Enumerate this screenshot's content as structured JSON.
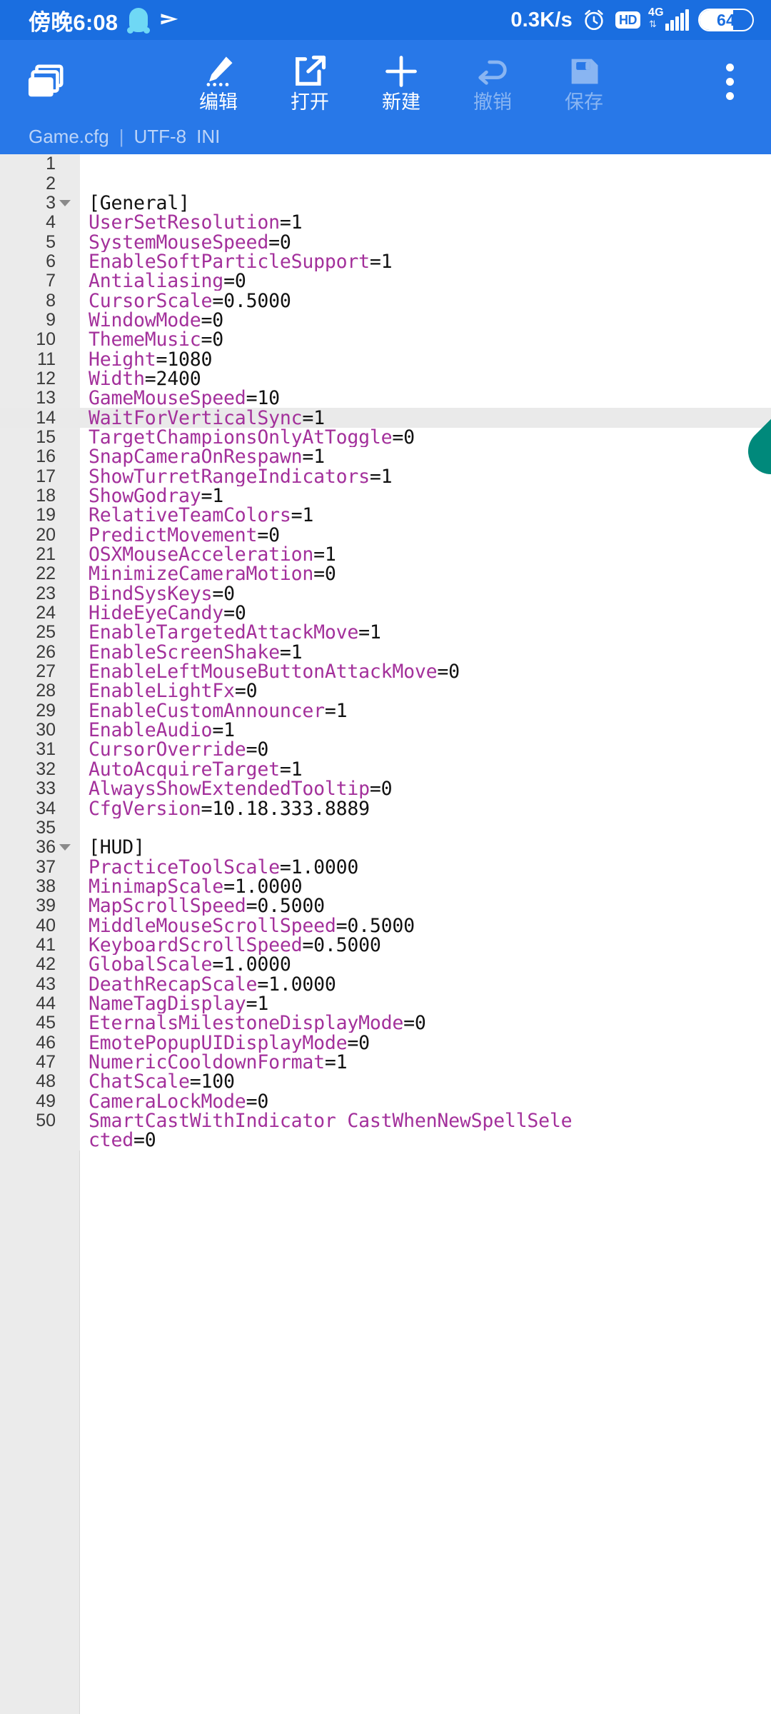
{
  "statusbar": {
    "time": "傍晚6:08",
    "qq_icon": "qq-penguin-icon",
    "plane_icon": "paper-plane-icon",
    "network_speed": "0.3K/s",
    "alarm_icon": "alarm-clock-icon",
    "hd_badge": "HD",
    "signal_type": "4G",
    "battery_level": "64",
    "bg_color": "#1a6ee0"
  },
  "toolbar": {
    "bg_color": "#2878e8",
    "windows_icon": "window-stack-icon",
    "items": [
      {
        "label": "编辑",
        "icon": "pencil-edit-icon",
        "enabled": true
      },
      {
        "label": "打开",
        "icon": "open-external-icon",
        "enabled": true
      },
      {
        "label": "新建",
        "icon": "plus-new-icon",
        "enabled": true
      },
      {
        "label": "撤销",
        "icon": "undo-arrow-icon",
        "enabled": false
      },
      {
        "label": "保存",
        "icon": "floppy-save-icon",
        "enabled": false
      }
    ],
    "overflow_icon": "more-vertical-icon"
  },
  "fileinfo": {
    "filename": "Game.cfg",
    "separator": "|",
    "encoding": "UTF-8",
    "filetype": "INI"
  },
  "editor": {
    "accent_key_color": "#a3309b",
    "value_color": "#111111",
    "gutter_color": "#ebebeb",
    "highlight_color": "#eaeaea",
    "cursor_handle_color": "#00897b",
    "active_line": 14,
    "lines": [
      {
        "n": 1,
        "fold": false,
        "key": "",
        "val": "",
        "section": ""
      },
      {
        "n": 2,
        "fold": false,
        "key": "",
        "val": "",
        "section": ""
      },
      {
        "n": 3,
        "fold": true,
        "key": "",
        "val": "",
        "section": "[General]"
      },
      {
        "n": 4,
        "fold": false,
        "key": "UserSetResolution",
        "val": "=1"
      },
      {
        "n": 5,
        "fold": false,
        "key": "SystemMouseSpeed",
        "val": "=0"
      },
      {
        "n": 6,
        "fold": false,
        "key": "EnableSoftParticleSupport",
        "val": "=1"
      },
      {
        "n": 7,
        "fold": false,
        "key": "Antialiasing",
        "val": "=0"
      },
      {
        "n": 8,
        "fold": false,
        "key": "CursorScale",
        "val": "=0.5000"
      },
      {
        "n": 9,
        "fold": false,
        "key": "WindowMode",
        "val": "=0"
      },
      {
        "n": 10,
        "fold": false,
        "key": "ThemeMusic",
        "val": "=0"
      },
      {
        "n": 11,
        "fold": false,
        "key": "Height",
        "val": "=1080"
      },
      {
        "n": 12,
        "fold": false,
        "key": "Width",
        "val": "=2400"
      },
      {
        "n": 13,
        "fold": false,
        "key": "GameMouseSpeed",
        "val": "=10"
      },
      {
        "n": 14,
        "fold": false,
        "key": "WaitForVerticalSync",
        "val": "=1"
      },
      {
        "n": 15,
        "fold": false,
        "key": "TargetChampionsOnlyAtToggle",
        "val": "=0"
      },
      {
        "n": 16,
        "fold": false,
        "key": "SnapCameraOnRespawn",
        "val": "=1"
      },
      {
        "n": 17,
        "fold": false,
        "key": "ShowTurretRangeIndicators",
        "val": "=1"
      },
      {
        "n": 18,
        "fold": false,
        "key": "ShowGodray",
        "val": "=1"
      },
      {
        "n": 19,
        "fold": false,
        "key": "RelativeTeamColors",
        "val": "=1"
      },
      {
        "n": 20,
        "fold": false,
        "key": "PredictMovement",
        "val": "=0"
      },
      {
        "n": 21,
        "fold": false,
        "key": "OSXMouseAcceleration",
        "val": "=1"
      },
      {
        "n": 22,
        "fold": false,
        "key": "MinimizeCameraMotion",
        "val": "=0"
      },
      {
        "n": 23,
        "fold": false,
        "key": "BindSysKeys",
        "val": "=0"
      },
      {
        "n": 24,
        "fold": false,
        "key": "HideEyeCandy",
        "val": "=0"
      },
      {
        "n": 25,
        "fold": false,
        "key": "EnableTargetedAttackMove",
        "val": "=1"
      },
      {
        "n": 26,
        "fold": false,
        "key": "EnableScreenShake",
        "val": "=1"
      },
      {
        "n": 27,
        "fold": false,
        "key": "EnableLeftMouseButtonAttackMove",
        "val": "=0"
      },
      {
        "n": 28,
        "fold": false,
        "key": "EnableLightFx",
        "val": "=0"
      },
      {
        "n": 29,
        "fold": false,
        "key": "EnableCustomAnnouncer",
        "val": "=1"
      },
      {
        "n": 30,
        "fold": false,
        "key": "EnableAudio",
        "val": "=1"
      },
      {
        "n": 31,
        "fold": false,
        "key": "CursorOverride",
        "val": "=0"
      },
      {
        "n": 32,
        "fold": false,
        "key": "AutoAcquireTarget",
        "val": "=1"
      },
      {
        "n": 33,
        "fold": false,
        "key": "AlwaysShowExtendedTooltip",
        "val": "=0"
      },
      {
        "n": 34,
        "fold": false,
        "key": "CfgVersion",
        "val": "=10.18.333.8889"
      },
      {
        "n": 35,
        "fold": false,
        "key": "",
        "val": "",
        "section": ""
      },
      {
        "n": 36,
        "fold": true,
        "key": "",
        "val": "",
        "section": "[HUD]"
      },
      {
        "n": 37,
        "fold": false,
        "key": "PracticeToolScale",
        "val": "=1.0000"
      },
      {
        "n": 38,
        "fold": false,
        "key": "MinimapScale",
        "val": "=1.0000"
      },
      {
        "n": 39,
        "fold": false,
        "key": "MapScrollSpeed",
        "val": "=0.5000"
      },
      {
        "n": 40,
        "fold": false,
        "key": "MiddleMouseScrollSpeed",
        "val": "=0.5000"
      },
      {
        "n": 41,
        "fold": false,
        "key": "KeyboardScrollSpeed",
        "val": "=0.5000"
      },
      {
        "n": 42,
        "fold": false,
        "key": "GlobalScale",
        "val": "=1.0000"
      },
      {
        "n": 43,
        "fold": false,
        "key": "DeathRecapScale",
        "val": "=1.0000"
      },
      {
        "n": 44,
        "fold": false,
        "key": "NameTagDisplay",
        "val": "=1"
      },
      {
        "n": 45,
        "fold": false,
        "key": "EternalsMilestoneDisplayMode",
        "val": "=0"
      },
      {
        "n": 46,
        "fold": false,
        "key": "EmotePopupUIDisplayMode",
        "val": "=0"
      },
      {
        "n": 47,
        "fold": false,
        "key": "NumericCooldownFormat",
        "val": "=1"
      },
      {
        "n": 48,
        "fold": false,
        "key": "ChatScale",
        "val": "=100"
      },
      {
        "n": 49,
        "fold": false,
        "key": "CameraLockMode",
        "val": "=0"
      },
      {
        "n": 50,
        "fold": false,
        "key": "SmartCastWithIndicator_CastWhenNewSpellSele",
        "val": ""
      },
      {
        "n": "",
        "fold": false,
        "key": "cted",
        "val": "=0"
      }
    ]
  }
}
